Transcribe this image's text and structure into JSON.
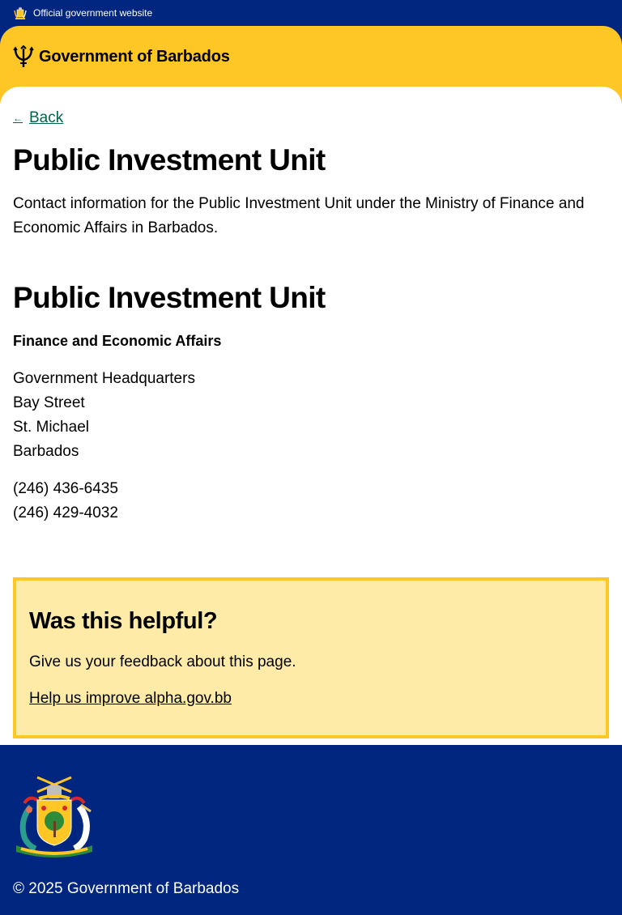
{
  "official_bar": {
    "text": "Official government website",
    "icon": "coat-of-arms-icon"
  },
  "header": {
    "brand": "Government of Barbados",
    "icon": "trident-icon",
    "color": "#ffc726"
  },
  "nav": {
    "back_label": "Back"
  },
  "page": {
    "title": "Public Investment Unit",
    "lede": "Contact information for the Public Investment Unit under the Ministry of Finance and Economic Affairs in Barbados."
  },
  "contact": {
    "name": "Public Investment Unit",
    "ministry": "Finance and Economic Affairs",
    "address": [
      "Government Headquarters",
      "Bay Street",
      "St. Michael",
      "Barbados"
    ],
    "phones": [
      "(246) 436-6435",
      "(246) 429-4032"
    ]
  },
  "feedback": {
    "title": "Was this helpful?",
    "text": "Give us your feedback about this page.",
    "link": "Help us improve alpha.gov.bb"
  },
  "footer": {
    "copyright": "© 2025 Government of Barbados"
  },
  "colors": {
    "navy": "#00267f",
    "yellow": "#ffc726",
    "feedback_bg": "#ffeba8",
    "link_green": "#00654a"
  }
}
